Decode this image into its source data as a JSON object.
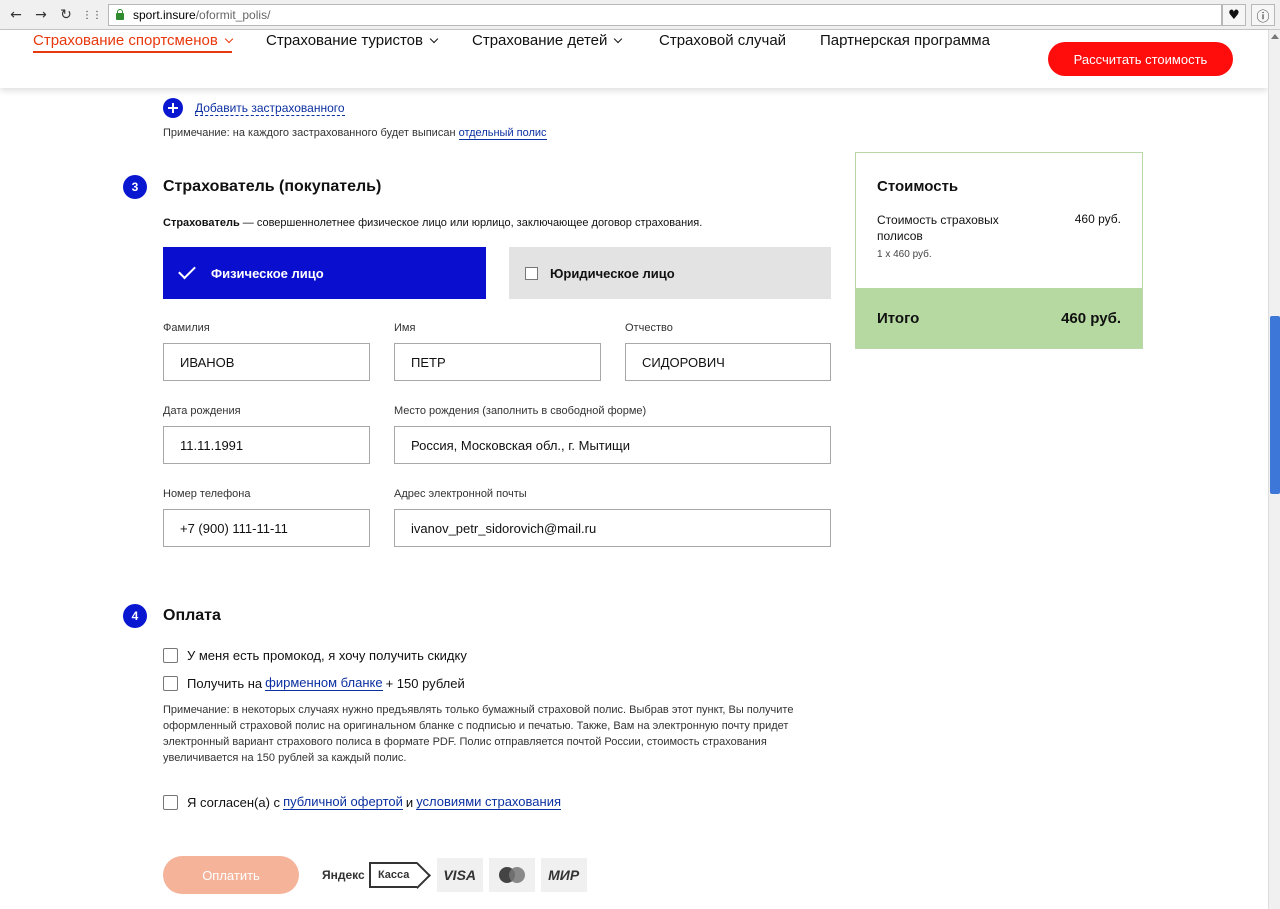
{
  "browser": {
    "url_host": "sport.insure",
    "url_path": "/oformit_polis/",
    "back_glyph": "←",
    "forward_glyph": "→",
    "reload_glyph": "↻",
    "apps_glyph": "⋮⋮",
    "fav_glyph": "♥",
    "info_glyph": "ⓘ"
  },
  "header": {
    "nav": [
      {
        "label": "Страхование спортсменов",
        "active": true,
        "dropdown": true
      },
      {
        "label": "Страхование туристов",
        "active": false,
        "dropdown": true
      },
      {
        "label": "Страхование детей",
        "active": false,
        "dropdown": true
      },
      {
        "label": "Страховой случай",
        "active": false,
        "dropdown": false
      },
      {
        "label": "Партнерская программа",
        "active": false,
        "dropdown": false
      }
    ],
    "cta_label": "Рассчитать стоимость"
  },
  "insured": {
    "add_label": "Добавить застрахованного",
    "note_prefix": "Примечание: на каждого застрахованного будет выписан",
    "note_link": "отдельный полис"
  },
  "policyholder": {
    "step": "3",
    "title": "Страхователь (покупатель)",
    "desc_bold": "Страхователь",
    "desc_rest": " — совершеннолетнее физическое лицо или юрлицо, заключающее договор страхования.",
    "type_physical": "Физическое лицо",
    "type_legal": "Юридическое лицо",
    "fields": {
      "surname_label": "Фамилия",
      "surname_value": "ИВАНОВ",
      "name_label": "Имя",
      "name_value": "ПЕТР",
      "patronymic_label": "Отчество",
      "patronymic_value": "СИДОРОВИЧ",
      "birthdate_label": "Дата рождения",
      "birthdate_value": "11.11.1991",
      "birthplace_label": "Место рождения (заполнить в свободной форме)",
      "birthplace_value": "Россия, Московская обл., г. Мытищи",
      "phone_label": "Номер телефона",
      "phone_value": "+7 (900) 111-11-11",
      "email_label": "Адрес электронной почты",
      "email_value": "ivanov_petr_sidorovich@mail.ru"
    }
  },
  "payment": {
    "step": "4",
    "title": "Оплата",
    "promo_label": "У меня есть промокод, я хочу получить скидку",
    "blank_prefix": "Получить на",
    "blank_link": "фирменном бланке",
    "blank_suffix": "+ 150 рублей",
    "note": "Примечание: в некоторых случаях нужно предъявлять только бумажный страховой полис. Выбрав этот пункт, Вы получите оформленный страховой полис на оригинальном бланке с подписью и печатью. Также, Вам на электронную почту придет электронный вариант страхового полиса в формате PDF. Полис отправляется почтой России, стоимость страхования увеличивается на 150 рублей за каждый полис.",
    "agree_prefix": "Я согласен(а) с",
    "agree_link1": "публичной офертой",
    "agree_mid": "и",
    "agree_link2": "условиями страхования",
    "pay_label": "Оплатить",
    "logos": {
      "yandex": "Яндекс",
      "kassa": "Касса",
      "visa": "VISA",
      "mir": "МИР"
    }
  },
  "summary": {
    "title": "Стоимость",
    "line_label": "Стоимость страховых полисов",
    "line_price": "460 руб.",
    "line_sub": "1 х 460 руб.",
    "total_label": "Итого",
    "total_price": "460 руб."
  },
  "colors": {
    "accent": "#0a17d0",
    "brand_red": "#ff0d0d",
    "total_green": "#b5d9a0"
  }
}
